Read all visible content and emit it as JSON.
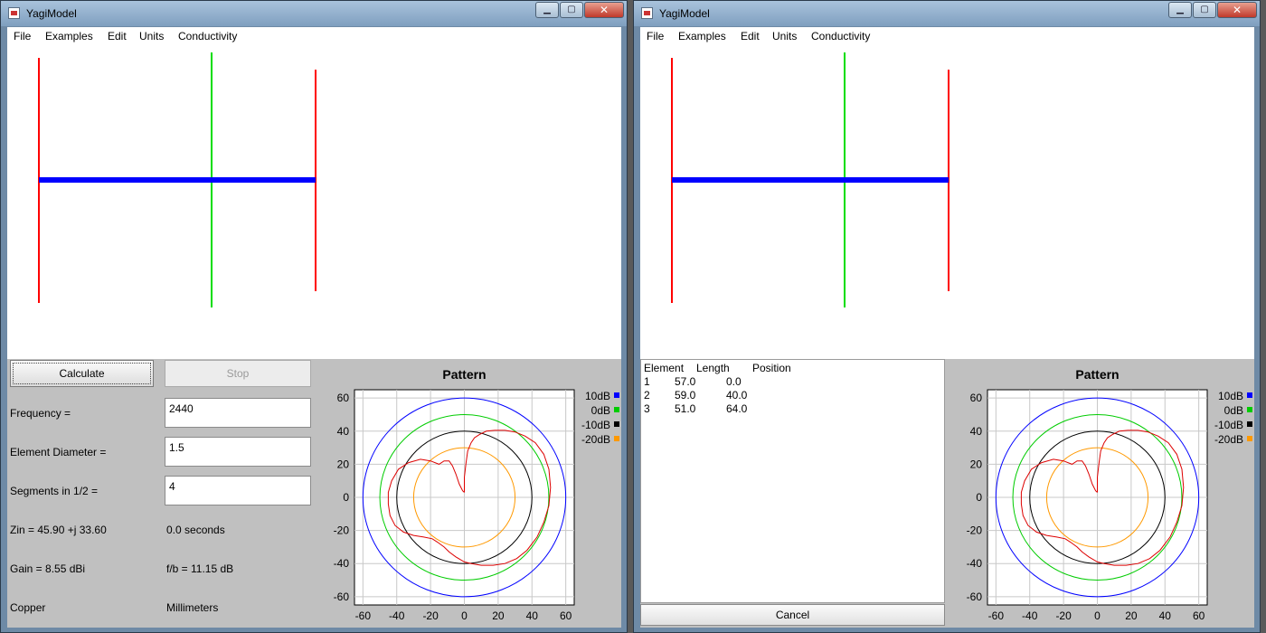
{
  "windows": [
    {
      "title": "YagiModel",
      "menu": [
        "File",
        "Examples",
        "Edit",
        "Units",
        "Conductivity"
      ],
      "controls": {
        "calculate_label": "Calculate",
        "stop_label": "Stop",
        "frequency_label": "Frequency =",
        "frequency_value": "2440",
        "diameter_label": "Element Diameter =",
        "diameter_value": "1.5",
        "segments_label": "Segments in 1/2 =",
        "segments_value": "4",
        "zin": "Zin = 45.90 +j 33.60",
        "time": "0.0 seconds",
        "gain": "Gain = 8.55 dBi",
        "fb": "f/b = 11.15 dB",
        "conductivity": "Copper",
        "units": "Millimeters"
      }
    },
    {
      "title": "YagiModel",
      "menu": [
        "File",
        "Examples",
        "Edit",
        "Units",
        "Conductivity"
      ],
      "table": {
        "headers": [
          "Element",
          "Length",
          "Position"
        ],
        "rows": [
          [
            "1",
            "57.0",
            "0.0"
          ],
          [
            "2",
            "59.0",
            "40.0"
          ],
          [
            "3",
            "51.0",
            "64.0"
          ]
        ]
      },
      "cancel_label": "Cancel"
    }
  ],
  "colors": {
    "boom": "#0000ff",
    "driven": "#00dd00",
    "parasitic": "#ff0000",
    "ring_10db": "#0000ff",
    "ring_0db": "#00cc00",
    "ring_m10db": "#000000",
    "ring_m20db": "#ff9900",
    "pattern_trace": "#dd0000"
  },
  "chart_data": {
    "type": "polar-pattern",
    "title": "Pattern",
    "xlim": [
      -65,
      65
    ],
    "ylim": [
      -65,
      65
    ],
    "x_ticks": [
      -60,
      -40,
      -20,
      0,
      20,
      40,
      60
    ],
    "y_ticks": [
      60,
      40,
      20,
      0,
      -20,
      -40,
      -60
    ],
    "grid": true,
    "legend_position": "right",
    "legend": [
      {
        "label": "10dB",
        "color": "#0000ff",
        "radius": 60
      },
      {
        "label": "0dB",
        "color": "#00cc00",
        "radius": 50
      },
      {
        "label": "-10dB",
        "color": "#000000",
        "radius": 40
      },
      {
        "label": "-20dB",
        "color": "#ff9900",
        "radius": 30
      }
    ],
    "pattern": [
      [
        0,
        3
      ],
      [
        0,
        12
      ],
      [
        1,
        21
      ],
      [
        2,
        28
      ],
      [
        4,
        33
      ],
      [
        6,
        36
      ],
      [
        9,
        38
      ],
      [
        13,
        40
      ],
      [
        18,
        40.5
      ],
      [
        24,
        40.5
      ],
      [
        30,
        39.5
      ],
      [
        36,
        37
      ],
      [
        42,
        33
      ],
      [
        47,
        26
      ],
      [
        50,
        17
      ],
      [
        51,
        6
      ],
      [
        50,
        -5
      ],
      [
        47,
        -15
      ],
      [
        43,
        -24
      ],
      [
        37,
        -32
      ],
      [
        31,
        -37
      ],
      [
        24,
        -40
      ],
      [
        17,
        -41
      ],
      [
        10,
        -41
      ],
      [
        4,
        -40
      ],
      [
        0,
        -39
      ],
      [
        -5,
        -36
      ],
      [
        -9,
        -33
      ],
      [
        -12,
        -30
      ],
      [
        -16,
        -27
      ],
      [
        -19,
        -25
      ],
      [
        -24,
        -24
      ],
      [
        -30,
        -23
      ],
      [
        -36,
        -21
      ],
      [
        -41,
        -17
      ],
      [
        -44,
        -11
      ],
      [
        -45,
        -4
      ],
      [
        -45,
        3
      ],
      [
        -43,
        10
      ],
      [
        -39,
        17
      ],
      [
        -33,
        21
      ],
      [
        -26,
        23
      ],
      [
        -20,
        22
      ],
      [
        -15,
        20
      ],
      [
        -12,
        22
      ],
      [
        -9,
        22
      ],
      [
        -7,
        19
      ],
      [
        -5,
        14
      ],
      [
        -3,
        8
      ],
      [
        -1,
        4
      ],
      [
        0,
        3
      ]
    ]
  }
}
